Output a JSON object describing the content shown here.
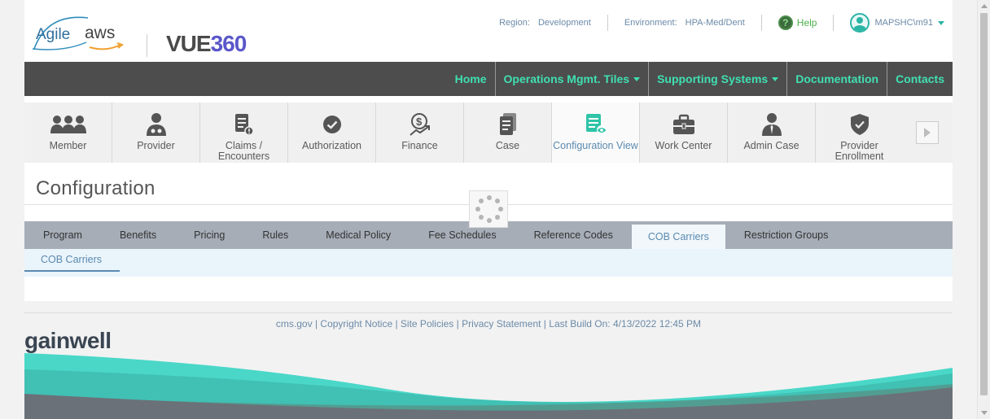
{
  "header": {
    "agile_text": "Agile",
    "aws_text": "aws",
    "vue_text": "VUE",
    "vue_num": "360",
    "region_label": "Region:",
    "region_value": "Development",
    "env_label": "Environment:",
    "env_value": "HPA-Med/Dent",
    "help_label": "Help",
    "user_name": "MAPSHC\\m91"
  },
  "topnav": {
    "items": [
      {
        "label": "Home"
      },
      {
        "label": "Operations Mgmt. Tiles"
      },
      {
        "label": "Supporting Systems"
      },
      {
        "label": "Documentation"
      },
      {
        "label": "Contacts"
      }
    ]
  },
  "tiles": [
    {
      "label": "Member",
      "icon": "members-icon"
    },
    {
      "label": "Provider",
      "icon": "doctor-icon"
    },
    {
      "label": "Claims / Encounters",
      "icon": "claims-icon"
    },
    {
      "label": "Authorization",
      "icon": "check-circle-icon"
    },
    {
      "label": "Finance",
      "icon": "dollar-hand-icon"
    },
    {
      "label": "Case",
      "icon": "document-icon"
    },
    {
      "label": "Configuration View",
      "icon": "config-list-icon"
    },
    {
      "label": "Work Center",
      "icon": "briefcase-icon"
    },
    {
      "label": "Admin Case",
      "icon": "admin-person-icon"
    },
    {
      "label": "Provider Enrollment",
      "icon": "shield-check-icon"
    }
  ],
  "page": {
    "title": "Configuration"
  },
  "subtabs": [
    {
      "label": "Program"
    },
    {
      "label": "Benefits"
    },
    {
      "label": "Pricing"
    },
    {
      "label": "Rules"
    },
    {
      "label": "Medical Policy"
    },
    {
      "label": "Fee Schedules"
    },
    {
      "label": "Reference Codes"
    },
    {
      "label": "COB Carriers"
    },
    {
      "label": "Restriction Groups"
    }
  ],
  "active_subtab": "COB Carriers",
  "subsub": {
    "active_label": "COB Carriers"
  },
  "footer": {
    "links": [
      "cms.gov",
      "Copyright Notice",
      "Site Policies",
      "Privacy Statement"
    ],
    "build": "Last Build On: 4/13/2022 12:45 PM",
    "brand": "gainwell"
  },
  "colors": {
    "nav_bg": "#4d4d4d",
    "nav_text": "#3fe0b0",
    "accent_blue": "#5a8ab0",
    "teal": "#2ab5a5",
    "subtab_bg": "#a6adb7"
  }
}
